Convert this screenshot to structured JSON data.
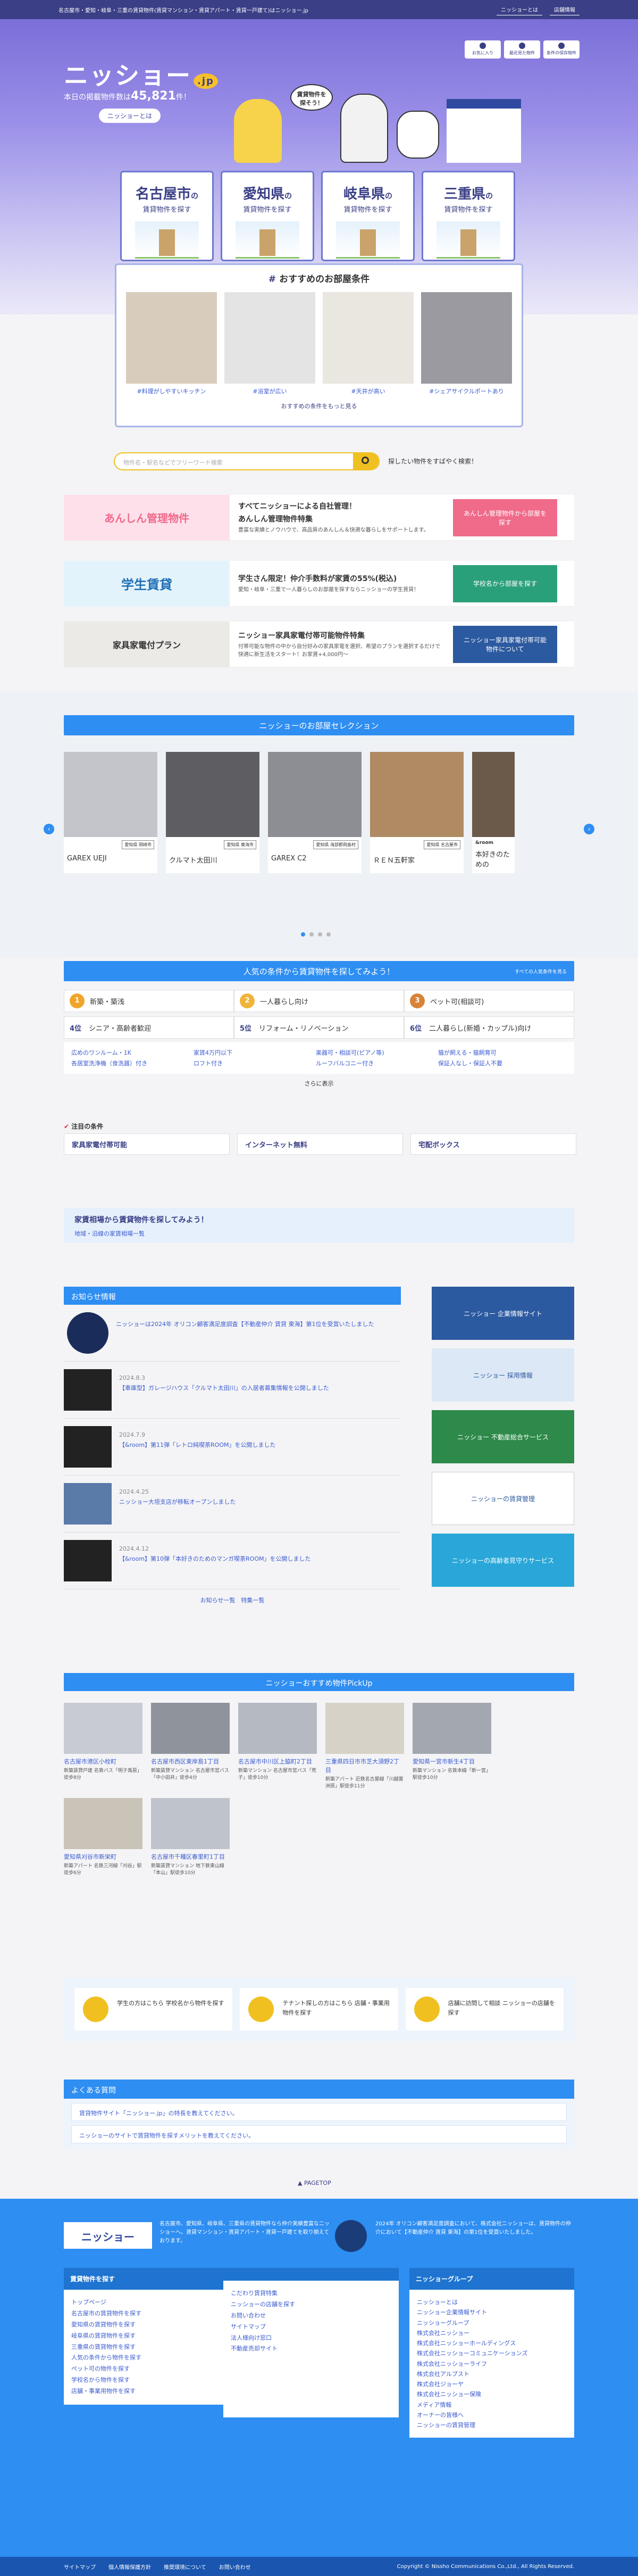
{
  "topbar": {
    "tagline": "名古屋市・愛知・岐阜・三重の賃貸物件(賃貸マンション・賃貸アパート・賃貸一戸建て)はニッショー.jp",
    "about": "ニッショーとは",
    "stores": "店舗情報"
  },
  "header": {
    "logo": "ニッショー",
    "logo_suffix": ".jp",
    "count_prefix": "本日の掲載物件数は",
    "count": "45,821",
    "count_suffix": "件！",
    "about_button": "ニッショーとは",
    "icons": [
      "お気に入り",
      "最近見た物件",
      "条件の保存物件"
    ],
    "bubble": "賃貸物件を探そう！"
  },
  "prefs": [
    {
      "name": "名古屋市",
      "suffix": "の",
      "sub": "賃貸物件を探す"
    },
    {
      "name": "愛知県",
      "suffix": "の",
      "sub": "賃貸物件を探す"
    },
    {
      "name": "岐阜県",
      "suffix": "の",
      "sub": "賃貸物件を探す"
    },
    {
      "name": "三重県",
      "suffix": "の",
      "sub": "賃貸物件を探す"
    }
  ],
  "recommend": {
    "title": "おすすめのお部屋条件",
    "items": [
      "#料理がしやすいキッチン",
      "#浴室が広い",
      "#天井が高い",
      "#シェアサイクルポートあり"
    ],
    "more": "おすすめの条件をもっと見る"
  },
  "search": {
    "placeholder": "物件名・駅名などでフリーワード検索",
    "note": "探したい物件をすばやく検索！"
  },
  "banners": [
    {
      "title": "すべてニッショーによる自社管理！",
      "subtitle": "あんしん管理物件特集",
      "body": "豊富な実績とノウハウで、高品質のあんしん＆快適な暮らしをサポートします。",
      "btn": "あんしん管理物件から部屋を探す",
      "color": "#f06a8a",
      "pic": "あんしん管理物件"
    },
    {
      "title": "学生さん限定！仲介手数料が家賃の55%(税込)",
      "subtitle": "",
      "body": "愛知・岐阜・三重で一人暮らしのお部屋を探すならニッショーの学生賃貸！",
      "btn": "学校名から部屋を探す",
      "color": "#2aa07a",
      "pic": "学生賃貸"
    },
    {
      "title": "ニッショー家具家電付帯可能物件特集",
      "subtitle": "",
      "body": "付帯可能な物件の中から自分好みの家具家電を選択、希望のプランを選択するだけで快適に新生活をスタート！お家賃+4,000円〜",
      "btn": "ニッショー家具家電付帯可能物件について",
      "color": "#2c5aa0",
      "pic": "家具家電付プラン"
    }
  ],
  "selection": {
    "title": "ニッショーのお部屋セレクション",
    "items": [
      {
        "tag": "愛知県 岡崎市",
        "name": "GAREX UEJI"
      },
      {
        "tag": "愛知県 東海市",
        "name": "クルマト太田川"
      },
      {
        "tag": "愛知県 海部郡飛島村",
        "name": "GAREX C2"
      },
      {
        "tag": "愛知県 名古屋市",
        "name": "ＲＥＮ五軒家"
      },
      {
        "tag": "",
        "name": "本好きのための"
      }
    ],
    "logo": "&room"
  },
  "conditions": {
    "title": "人気の条件から賃貸物件を探してみよう！",
    "more_title": "すべての人気条件を見る",
    "top": [
      {
        "n": "1",
        "label": "新築・築浅"
      },
      {
        "n": "2",
        "label": "一人暮らし向け"
      },
      {
        "n": "3",
        "label": "ペット可(相談可)"
      }
    ],
    "second": [
      {
        "n": "4位",
        "label": "シニア・高齢者歓迎"
      },
      {
        "n": "5位",
        "label": "リフォーム・リノベーション"
      },
      {
        "n": "6位",
        "label": "二人暮らし(新婚・カップル)向け"
      }
    ],
    "links": [
      "広めのワンルーム・1K",
      "家賃4万円以下",
      "楽器可・相談可(ピアノ等)",
      "猫が飼える・猫飼育可",
      "各居室洗浄機（食洗器）付き",
      "ロフト付き",
      "ルーフバルコニー付き",
      "保証人なし・保証人不要"
    ],
    "show_more": "さらに表示"
  },
  "attention": {
    "title": "注目の条件",
    "items": [
      "家具家電付帯可能",
      "インターネット無料",
      "宅配ボックス"
    ]
  },
  "around": {
    "title": "家賃相場から賃貸物件を探してみよう！",
    "link": "地域・沿線の家賃相場一覧"
  },
  "news": {
    "title": "お知らせ情報",
    "items": [
      {
        "date": "",
        "text": "ニッショーは2024年 オリコン顧客満足度調査【不動産仲介 賃貸 東海】第1位を受賞いたしました"
      },
      {
        "date": "2024.8.3",
        "text": "【車庫型】ガレージハウス「クルマト太田川」の入居者募集情報を公開しました"
      },
      {
        "date": "2024.7.9",
        "text": "【&room】第11弾「レトロ純喫茶ROOM」を公開しました"
      },
      {
        "date": "2024.4.25",
        "text": "ニッショー大垣支店が移転オープンしました"
      },
      {
        "date": "2024.4.12",
        "text": "【&room】第10弾「本好きのためのマンガ喫茶ROOM」を公開しました"
      }
    ],
    "more": "お知らせ一覧",
    "more2": "特集一覧"
  },
  "side": [
    "ニッショー 企業情報サイト",
    "ニッショー 採用情報",
    "ニッショー 不動産総合サービス",
    "ニッショーの賃貸管理",
    "ニッショーの高齢者見守りサービス"
  ],
  "pickup": {
    "title": "ニッショーおすすめ物件PickUp",
    "items": [
      {
        "t": "名古屋市港区小栓町",
        "d": "新築賃貸戸建 名鉄バス「明子禹原」徒歩8分"
      },
      {
        "t": "名古屋市西区東岸島1丁目",
        "d": "新築賃貸マンション 名古屋市営バス「中小田井」徒歩4分"
      },
      {
        "t": "名古屋市中川区上脇町2丁目",
        "d": "新築マンション 名古屋市営バス「荒子」徒歩10分"
      },
      {
        "t": "三重県四日市市芝大須野2丁目",
        "d": "新築アパート 近鉄名古屋線「川越富洲原」駅徒歩11分"
      },
      {
        "t": "愛知県一宮市新生4丁目",
        "d": "新築マンション 名鉄本線「新一宮」駅徒歩10分"
      },
      {
        "t": "愛知県刈谷市新栄町",
        "d": "新築アパート 名鉄三河線「刈谷」駅徒歩6分"
      },
      {
        "t": "名古屋市千種区春里町1丁目",
        "d": "新築賃貸マンション 地下鉄東山線「本山」駅徒歩10分"
      }
    ]
  },
  "guide": [
    "学生の方はこちら 学校名から物件を探す",
    "テナント探しの方はこちら 店舗・事業用物件を探す",
    "店舗に訪問して相談 ニッショーの店舗を探す"
  ],
  "faq": {
    "title": "よくある質問",
    "items": [
      "賃貸物件サイト「ニッショー.jp」の特長を教えてください。",
      "ニッショーのサイトで賃貸物件を探すメリットを教えてください。"
    ]
  },
  "pagetop": "PAGETOP",
  "footer": {
    "logo": "ニッショー",
    "desc": "名古屋市、愛知県、岐阜県、三重県の賃貸物件なら仲介実績豊富なニッショーへ。賃貸マンション・賃貸アパート・賃貸一戸建てを取り揃えております。",
    "award": "2024年 オリコン顧客満足度調査において、株式会社ニッショーは、賃貸物件の仲介において【不動産仲介 賃貸 東海】の第1位を受賞いたしました。",
    "col1": {
      "title": "賃貸物件を探す",
      "items": [
        "トップページ",
        "名古屋市の賃貸物件を探す",
        "愛知県の賃貸物件を探す",
        "岐阜県の賃貸物件を探す",
        "三重県の賃貸物件を探す",
        "人気の条件から物件を探す",
        "ペット可の物件を探す",
        "学校名から物件を探す",
        "店舗・事業用物件を探す"
      ]
    },
    "col2": {
      "title": " ",
      "items": [
        "こだわり賃貸特集",
        "ニッショーの店舗を探す",
        "お問い合わせ",
        "サイトマップ",
        "法人様向け窓口",
        "不動産売却サイト"
      ]
    },
    "col3": {
      "title": "ニッショーグループ",
      "items": [
        "ニッショーとは",
        "ニッショー企業情報サイト",
        "ニッショーグループ",
        "株式会社ニッショー",
        "株式会社ニッショーホールディングス",
        "株式会社ニッショーコミュニケーションズ",
        "株式会社ニッショーライフ",
        "株式会社アルプスト",
        "株式会社ジョーヤ",
        "株式会社ニッショー保険",
        "メディア情報",
        "オーナーの皆様へ",
        "ニッショーの賃貸管理"
      ]
    },
    "bottom": [
      "サイトマップ",
      "個人情報保護方針",
      "推奨環境について",
      "お問い合わせ"
    ],
    "copyright": "Copyright © Nissho Communications Co.,Ltd., All Rights Reserved."
  }
}
